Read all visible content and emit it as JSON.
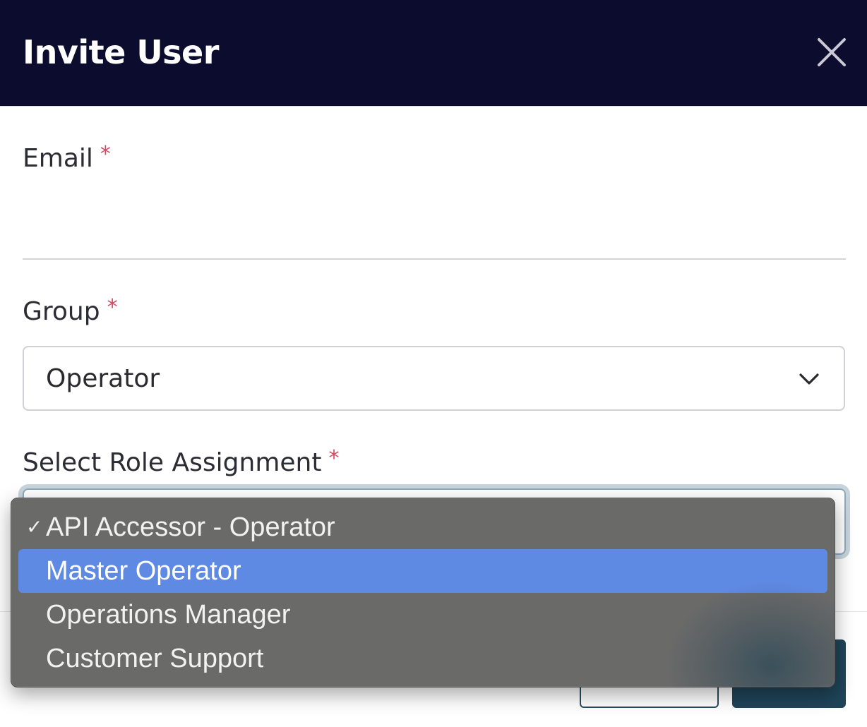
{
  "dialog": {
    "title": "Invite User",
    "close_icon": "close-icon"
  },
  "form": {
    "required_marker": "*",
    "email": {
      "label": "Email",
      "value": ""
    },
    "group": {
      "label": "Group",
      "selected": "Operator",
      "chevron_icon": "chevron-down-icon"
    },
    "role": {
      "label": "Select Role Assignment"
    }
  },
  "role_dropdown": {
    "options": [
      {
        "label": "API Accessor - Operator",
        "checked": true
      },
      {
        "label": "Master Operator",
        "highlighted": true
      },
      {
        "label": "Operations Manager"
      },
      {
        "label": "Customer Support"
      }
    ],
    "checkmark": "✓"
  },
  "colors": {
    "header_bg": "#0c0c2e",
    "required": "#d84a64",
    "highlight": "#5f8ae3",
    "primary_button": "#1f4459"
  }
}
